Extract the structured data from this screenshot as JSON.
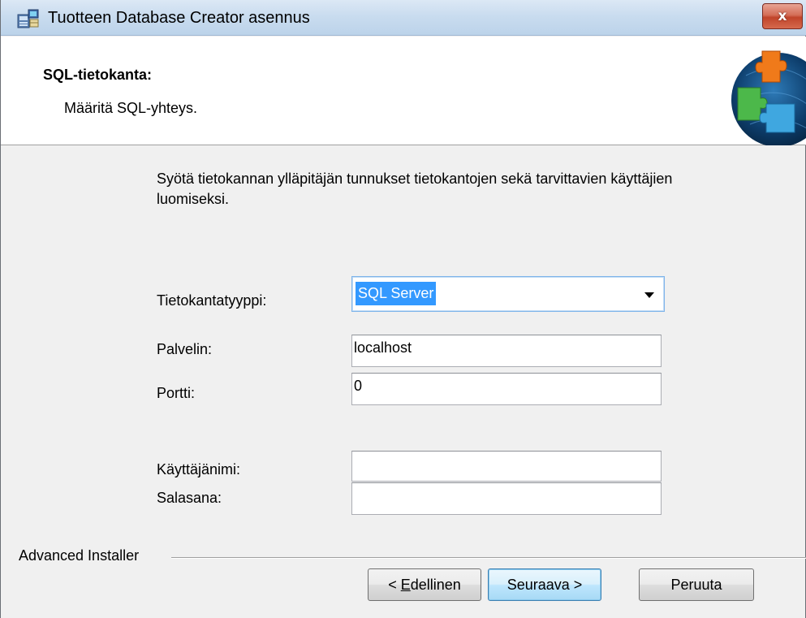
{
  "window": {
    "title": "Tuotteen Database Creator asennus",
    "close_label": "x",
    "app_icon": "installer-computer-icon",
    "accent": "#c0442a"
  },
  "banner": {
    "title": "SQL-tietokanta:",
    "subtitle": "Määritä SQL-yhteys.",
    "logo": "puzzle-arrow-logo"
  },
  "content": {
    "intro": "Syötä tietokannan ylläpitäjän tunnukset tietokantojen sekä tarvittavien käyttäjien luomiseksi.",
    "db_type": {
      "label": "Tietokantatyyppi:",
      "selected": "SQL Server"
    },
    "server": {
      "label": "Palvelin:",
      "value": "localhost"
    },
    "port": {
      "label": "Portti:",
      "value": "0"
    },
    "username": {
      "label": "Käyttäjänimi:",
      "value": ""
    },
    "password": {
      "label": "Salasana:",
      "value": ""
    }
  },
  "footer": {
    "brand": "Advanced Installer",
    "back_prefix": "< ",
    "back_accel": "E",
    "back_rest": "dellinen",
    "next_label": "Seuraava >",
    "cancel_label": "Peruuta"
  }
}
